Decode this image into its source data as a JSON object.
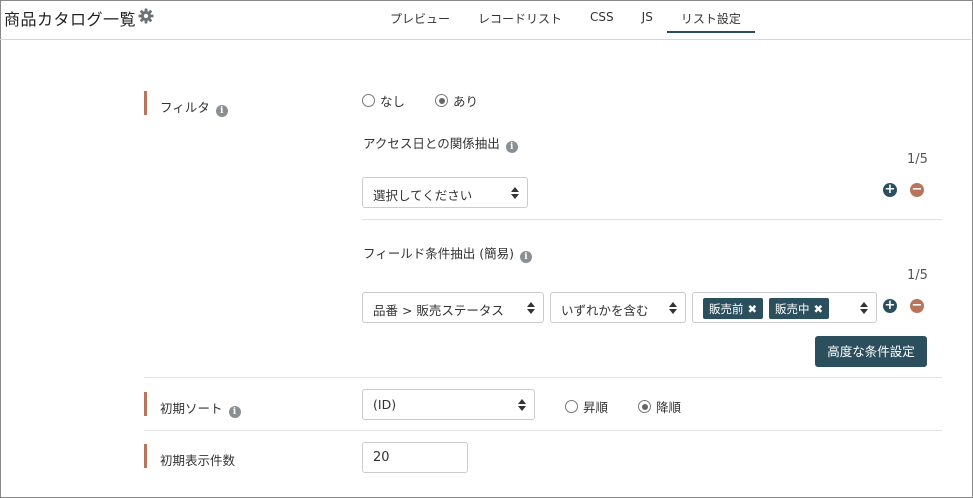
{
  "app": {
    "title": "商品カタログ一覧",
    "settings_icon": "gear-icon"
  },
  "tabs": [
    {
      "label": "プレビュー",
      "active": false
    },
    {
      "label": "レコードリスト",
      "active": false
    },
    {
      "label": "CSS",
      "active": false
    },
    {
      "label": "JS",
      "active": false
    },
    {
      "label": "リスト設定",
      "active": true
    }
  ],
  "filter": {
    "label": "フィルタ",
    "options": {
      "none": "なし",
      "some": "あり"
    },
    "selected": "あり",
    "access_date": {
      "label": "アクセス日との関係抽出",
      "counter": "1/5",
      "select_value": "選択してください"
    },
    "field_condition": {
      "label": "フィールド条件抽出 (簡易)",
      "counter": "1/5",
      "field_value": "品番 > 販売ステータス",
      "operator_value": "いずれかを含む",
      "tags": [
        "販売前",
        "販売中"
      ],
      "advanced_button": "高度な条件設定"
    }
  },
  "initial_sort": {
    "label": "初期ソート",
    "select_value": "(ID)",
    "options": {
      "asc": "昇順",
      "desc": "降順"
    },
    "selected": "降順"
  },
  "initial_count": {
    "label": "初期表示件数",
    "value": "20"
  },
  "colors": {
    "accent": "#2c4f5e",
    "label_bar": "#b8755c",
    "remove": "#b8755c"
  }
}
